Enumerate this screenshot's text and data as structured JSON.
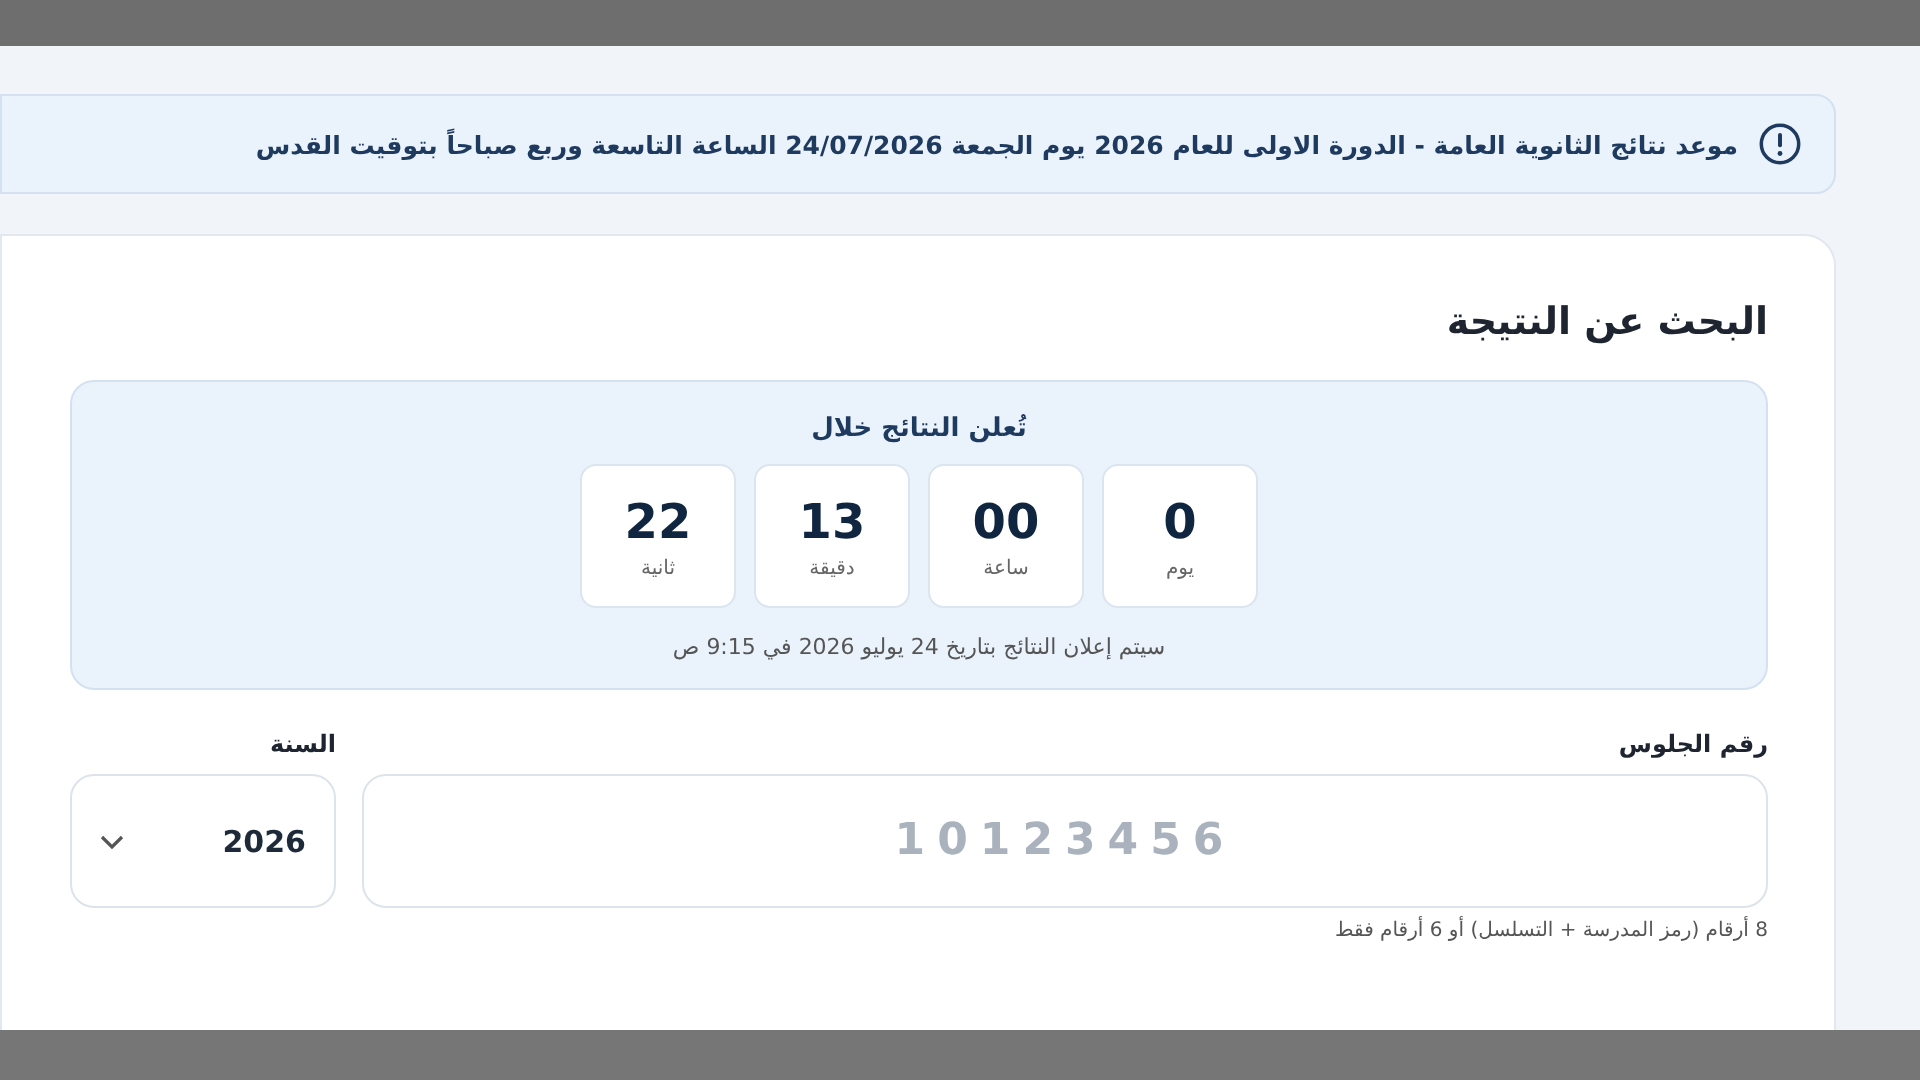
{
  "notice": {
    "text": "موعد نتائج الثانوية العامة - الدورة الاولى للعام 2026 يوم الجمعة 24/07/2026 الساعة التاسعة وربع صباحاً بتوقيت القدس"
  },
  "search_card": {
    "title": "البحث عن النتيجة",
    "countdown": {
      "heading": "تُعلن النتائج خلال",
      "units": [
        {
          "value": "0",
          "label": "يوم"
        },
        {
          "value": "00",
          "label": "ساعة"
        },
        {
          "value": "13",
          "label": "دقيقة"
        },
        {
          "value": "22",
          "label": "ثانية"
        }
      ],
      "note": "سيتم إعلان النتائج بتاريخ 24 يوليو 2026 في 9:15 ص"
    },
    "seat_number": {
      "label": "رقم الجلوس",
      "placeholder": "10123456",
      "hint": "8 أرقام (رمز المدرسة + التسلسل) أو 6 أرقام فقط"
    },
    "year": {
      "label": "السنة",
      "value": "2026"
    }
  }
}
